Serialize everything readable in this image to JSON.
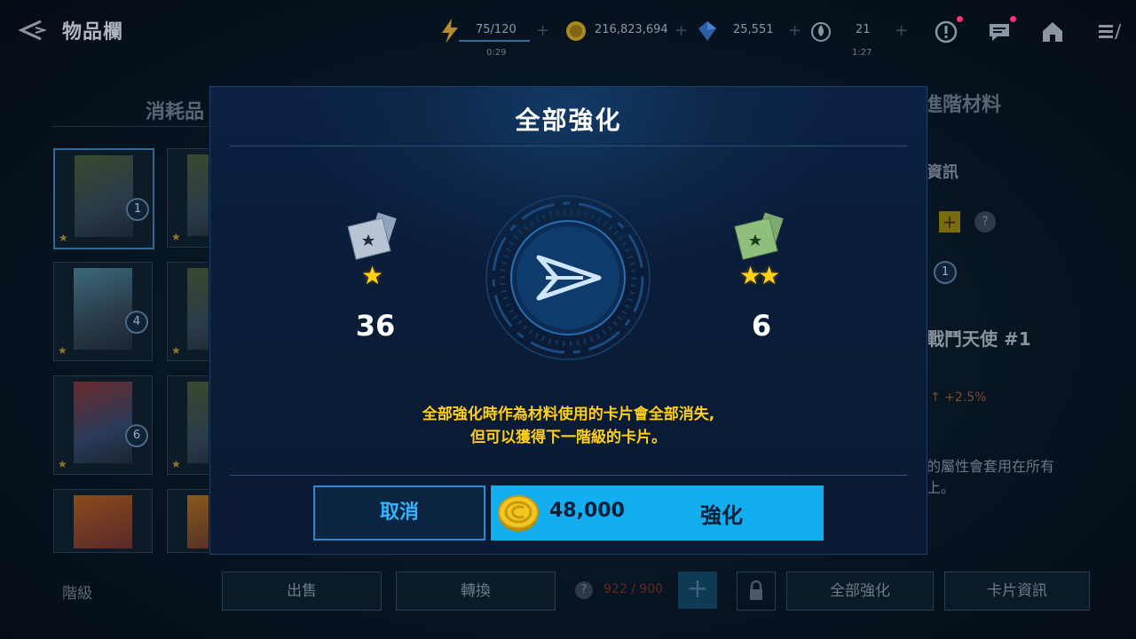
{
  "header": {
    "title": "物品欄",
    "energy": {
      "value": "75/120",
      "timer": "0:29"
    },
    "gold": {
      "value": "216,823,694"
    },
    "crystal": {
      "value": "25,551"
    },
    "stamina": {
      "value": "21",
      "timer": "1:27"
    },
    "plus_symbol": "+"
  },
  "background": {
    "tab_left": "消耗品",
    "tab_right": "進階材料",
    "info_title": "資訊",
    "card_name": "戰鬥天使 #1",
    "stat_bonus": "↑ +2.5%",
    "desc_line1": "的屬性會套用在所有",
    "desc_line2": "上。",
    "cards": [
      {
        "level": "1"
      },
      {
        "level": ""
      },
      {
        "level": "4"
      },
      {
        "level": ""
      },
      {
        "level": "6"
      },
      {
        "level": ""
      },
      {
        "level": ""
      },
      {
        "level": ""
      }
    ],
    "side_level": "1",
    "bottom": {
      "grade_label": "階級",
      "sell": "出售",
      "convert": "轉換",
      "count": "922 / 900",
      "enhance_all": "全部強化",
      "card_info": "卡片資訊"
    }
  },
  "modal": {
    "title": "全部強化",
    "from": {
      "stars": "★",
      "quantity": "36"
    },
    "to": {
      "stars": "★★",
      "quantity": "6"
    },
    "warning_line1": "全部強化時作為材料使用的卡片會全部消失,",
    "warning_line2": "但可以獲得下一階級的卡片。",
    "cancel_label": "取消",
    "cost": "48,000",
    "enhance_label": "強化"
  },
  "colors": {
    "accent": "#13aef0",
    "warning": "#ffcf1a",
    "star": "#ffd21a"
  }
}
